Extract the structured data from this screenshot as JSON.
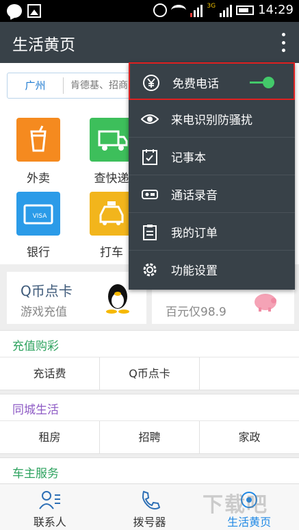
{
  "status_bar": {
    "time": "14:29",
    "network": "3G"
  },
  "app_bar": {
    "title": "生活黄页"
  },
  "search": {
    "city": "广州",
    "placeholder": "肯德基、招商"
  },
  "grid_items": [
    {
      "label": "外卖",
      "icon": "cup-icon",
      "color": "#f58a1f"
    },
    {
      "label": "查快递",
      "icon": "truck-icon",
      "color": "#3dbf5b"
    },
    {
      "label": "银行",
      "icon": "card-icon",
      "color": "#2b9be8"
    },
    {
      "label": "打车",
      "icon": "taxi-icon",
      "color": "#f2b51c"
    }
  ],
  "promos": [
    {
      "title": "Q币点卡",
      "subtitle": "游戏充值"
    },
    {
      "title": "",
      "subtitle": "百元仅98.9"
    }
  ],
  "sections": [
    {
      "title": "充值购彩",
      "color": "#2ea35f",
      "items": [
        "充话费",
        "Q币点卡"
      ]
    },
    {
      "title": "同城生活",
      "color": "#8e5bc5",
      "items": [
        "租房",
        "招聘",
        "家政"
      ]
    },
    {
      "title": "车主服务",
      "color": "#2ea35f",
      "items": []
    }
  ],
  "menu": {
    "items": [
      {
        "label": "免费电话",
        "icon": "yuan-icon",
        "toggle_on": true
      },
      {
        "label": "来电识别防骚扰",
        "icon": "eye-icon"
      },
      {
        "label": "记事本",
        "icon": "notepad-icon"
      },
      {
        "label": "通话录音",
        "icon": "recorder-icon"
      },
      {
        "label": "我的订单",
        "icon": "order-icon"
      },
      {
        "label": "功能设置",
        "icon": "gear-icon"
      }
    ]
  },
  "bottom_nav": [
    {
      "label": "联系人",
      "icon": "contacts-icon"
    },
    {
      "label": "拨号器",
      "icon": "phone-icon"
    },
    {
      "label": "生活黄页",
      "icon": "yellowpages-icon",
      "active": true
    }
  ],
  "watermark": "下载吧"
}
